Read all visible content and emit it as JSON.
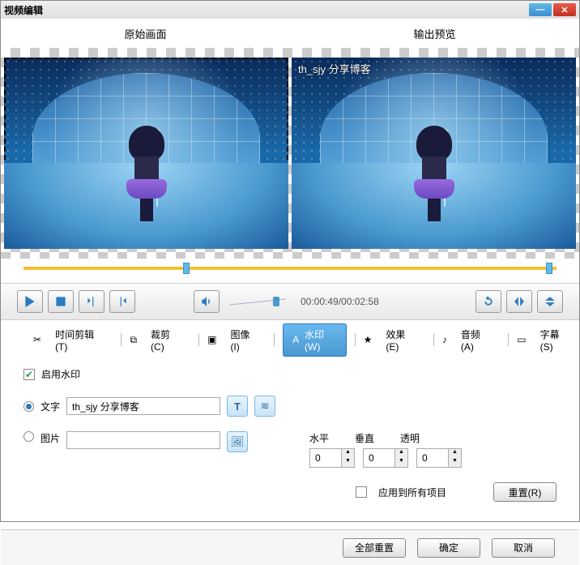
{
  "window": {
    "title": "视频编辑"
  },
  "headers": {
    "original": "原始画面",
    "output": "输出预览"
  },
  "preview_watermark": "th_sjy 分享博客",
  "timeline": {
    "left_pct": 30,
    "right_pct": 98
  },
  "timecode": "00:00:49/00:02:58",
  "tabs": {
    "clip": "时间剪辑(T)",
    "crop": "裁剪(C)",
    "image": "图像(I)",
    "water": "水印(W)",
    "effect": "效果(E)",
    "audio": "音频(A)",
    "sub": "字幕(S)"
  },
  "watermark": {
    "enable_label": "启用水印",
    "text_label": "文字",
    "text_value": "th_sjy 分享博客",
    "image_label": "图片",
    "h_label": "水平",
    "v_label": "垂直",
    "a_label": "透明",
    "h": "0",
    "v": "0",
    "a": "0",
    "apply_all": "应用到所有项目",
    "reset": "重置(R)"
  },
  "footer": {
    "reset_all": "全部重置",
    "ok": "确定",
    "cancel": "取消"
  }
}
